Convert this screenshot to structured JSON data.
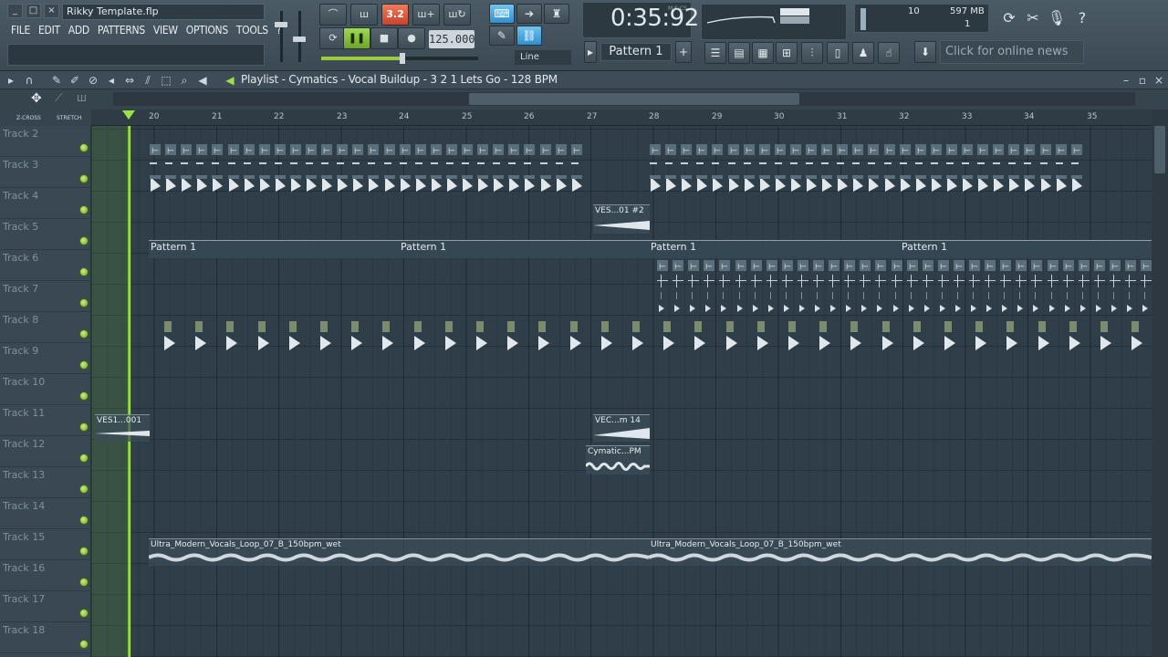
{
  "window": {
    "title": "Rikky Template.flp",
    "buttons": [
      "_",
      "□",
      "×"
    ]
  },
  "menu": [
    "FILE",
    "EDIT",
    "ADD",
    "PATTERNS",
    "VIEW",
    "OPTIONS",
    "TOOLS",
    "?"
  ],
  "transport": {
    "mode_label": "3.2",
    "tempo": "125.000",
    "pause_icon": "pause-icon",
    "stop_icon": "stop-icon",
    "record_icon": "record-icon"
  },
  "snap": {
    "label": "Line"
  },
  "time": {
    "value": "0:35:92",
    "sub_label": "M:S:CS"
  },
  "pattern": {
    "name": "Pattern 1",
    "add": "+"
  },
  "cpu": {
    "cpu_value": "10",
    "memory": "597 MB",
    "polyphony": "1"
  },
  "news": {
    "text": "Click for online news"
  },
  "playlist": {
    "title": "Playlist - Cymatics - Vocal Buildup - 3 2 1 Lets Go - 128 BPM",
    "mode_labels": [
      "Z-CROSS",
      "STRETCH"
    ],
    "ruler": [
      "20",
      "21",
      "22",
      "23",
      "24",
      "25",
      "26",
      "27",
      "28",
      "29",
      "30",
      "31",
      "32",
      "33",
      "34",
      "35"
    ],
    "tracks": [
      "Track 2",
      "Track 3",
      "Track 4",
      "Track 5",
      "Track 6",
      "Track 7",
      "Track 8",
      "Track 9",
      "Track 10",
      "Track 11",
      "Track 12",
      "Track 13",
      "Track 14",
      "Track 15",
      "Track 16",
      "Track 17",
      "Track 18"
    ],
    "clip_labels": {
      "ves01_2": "VES...01 #2",
      "pattern1": "Pattern 1",
      "ves1_001": "VES1...001",
      "vec_m14": "VEC...m 14",
      "cymatic_pm": "Cymatic...PM",
      "ultra_vocals": "Ultra_Modern_Vocals_Loop_07_B_150bpm_wet"
    }
  },
  "colors": {
    "accent_green": "#9ee04a",
    "playlist_bg": "#2f3e48",
    "header_bg": "#3a4853"
  }
}
